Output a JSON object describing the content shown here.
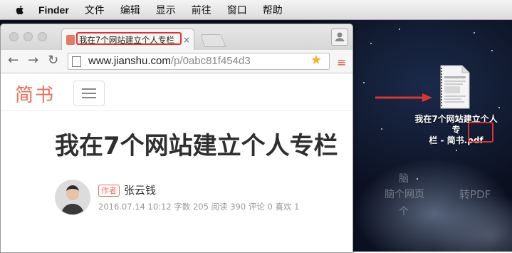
{
  "menubar": {
    "apple_icon": "apple-logo-icon",
    "app_name": "Finder",
    "items": [
      "文件",
      "编辑",
      "显示",
      "前往",
      "窗口",
      "帮助"
    ]
  },
  "browser": {
    "tab_title": "我在7个网站建立个人专栏",
    "tab_close": "×",
    "url_domain": "www.jianshu.com",
    "url_path": "/p/0abc81f454d3",
    "back_icon": "←",
    "forward_icon": "→",
    "reload_icon": "↻",
    "star_icon": "★",
    "menu_icon": "≡"
  },
  "site": {
    "logo": "简书",
    "accent_color": "#ea6f5a"
  },
  "article": {
    "title": "我在7个网站建立个人专栏",
    "author_badge": "作者",
    "author_name": "张云钱",
    "meta": "2016.07.14 10:12  字数 205  阅读 390  评论 0  喜欢 1"
  },
  "desktop": {
    "file_name_line1": "我在7个网站建立个人专",
    "file_name_line2": "栏 - 简书.pdf",
    "file_icon": "pdf-document-icon",
    "highlight_color": "#e0332f"
  }
}
